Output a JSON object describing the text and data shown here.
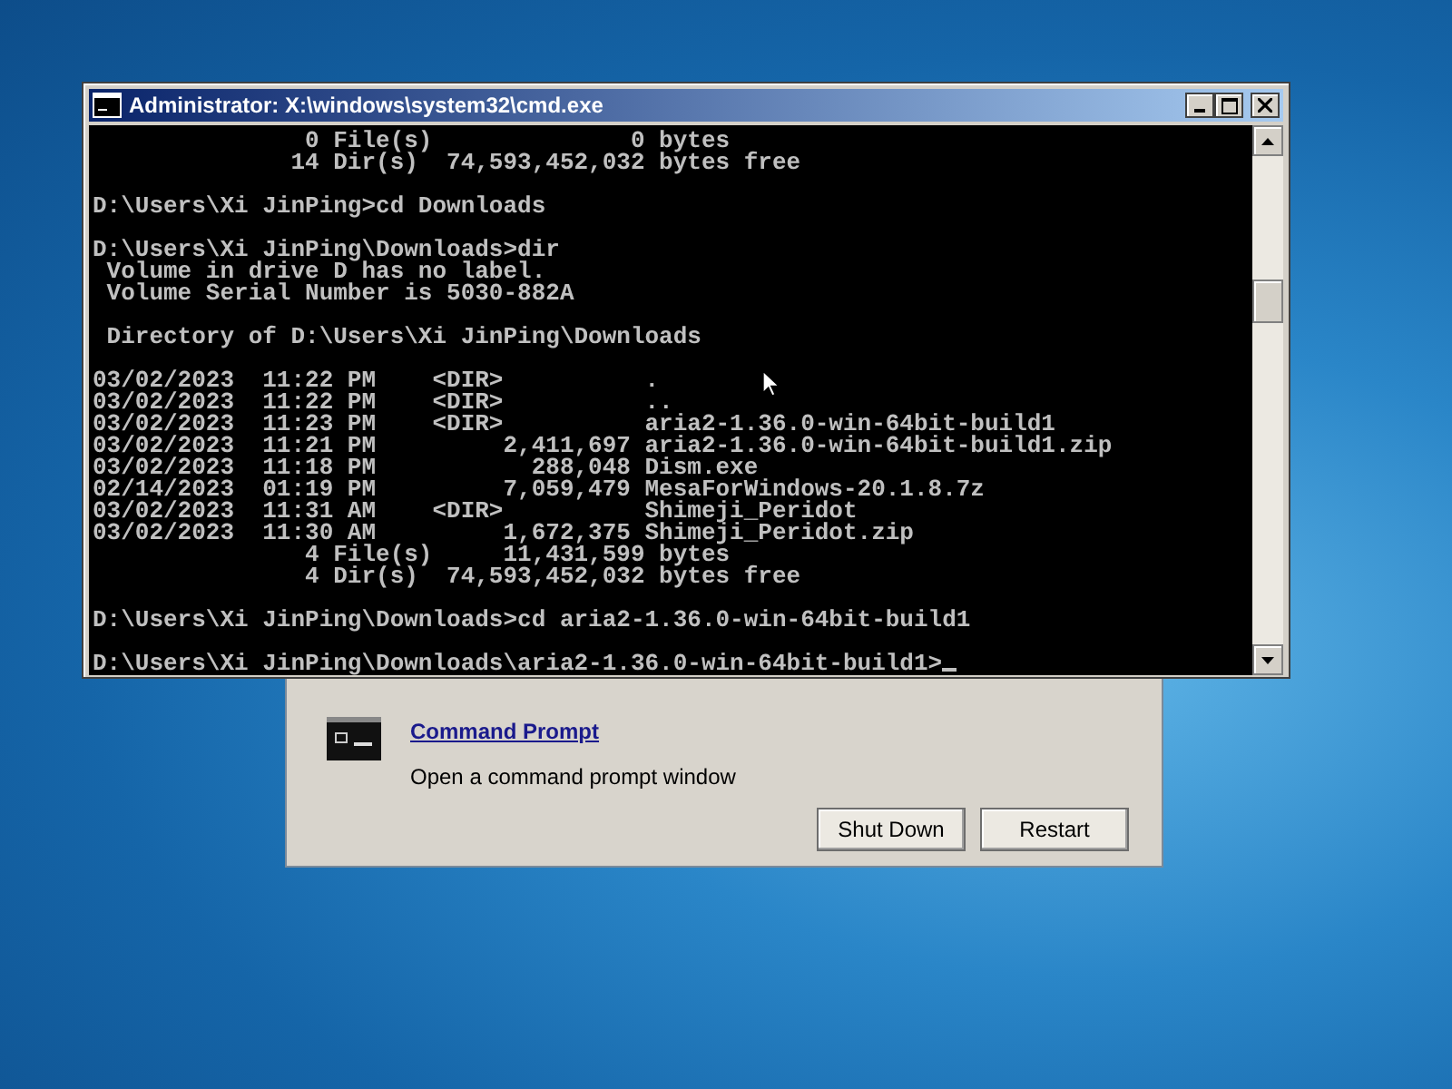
{
  "console_window": {
    "title": "Administrator: X:\\windows\\system32\\cmd.exe",
    "blocks": [
      [
        "               0 File(s)              0 bytes",
        "              14 Dir(s)  74,593,452,032 bytes free"
      ],
      [
        "D:\\Users\\Xi JinPing>cd Downloads"
      ],
      [
        "D:\\Users\\Xi JinPing\\Downloads>dir",
        " Volume in drive D has no label.",
        " Volume Serial Number is 5030-882A"
      ],
      [
        " Directory of D:\\Users\\Xi JinPing\\Downloads"
      ],
      [
        "03/02/2023  11:22 PM    <DIR>          .",
        "03/02/2023  11:22 PM    <DIR>          ..",
        "03/02/2023  11:23 PM    <DIR>          aria2-1.36.0-win-64bit-build1",
        "03/02/2023  11:21 PM         2,411,697 aria2-1.36.0-win-64bit-build1.zip",
        "03/02/2023  11:18 PM           288,048 Dism.exe",
        "02/14/2023  01:19 PM         7,059,479 MesaForWindows-20.1.8.7z",
        "03/02/2023  11:31 AM    <DIR>          Shimeji_Peridot",
        "03/02/2023  11:30 AM         1,672,375 Shimeji_Peridot.zip",
        "               4 File(s)     11,431,599 bytes",
        "               4 Dir(s)  74,593,452,032 bytes free"
      ],
      [
        "D:\\Users\\Xi JinPing\\Downloads>cd aria2-1.36.0-win-64bit-build1"
      ],
      [
        "D:\\Users\\Xi JinPing\\Downloads\\aria2-1.36.0-win-64bit-build1>"
      ]
    ]
  },
  "dialog": {
    "link": "Command Prompt",
    "description": "Open a command prompt window",
    "buttons": [
      "Shut Down",
      "Restart"
    ]
  }
}
